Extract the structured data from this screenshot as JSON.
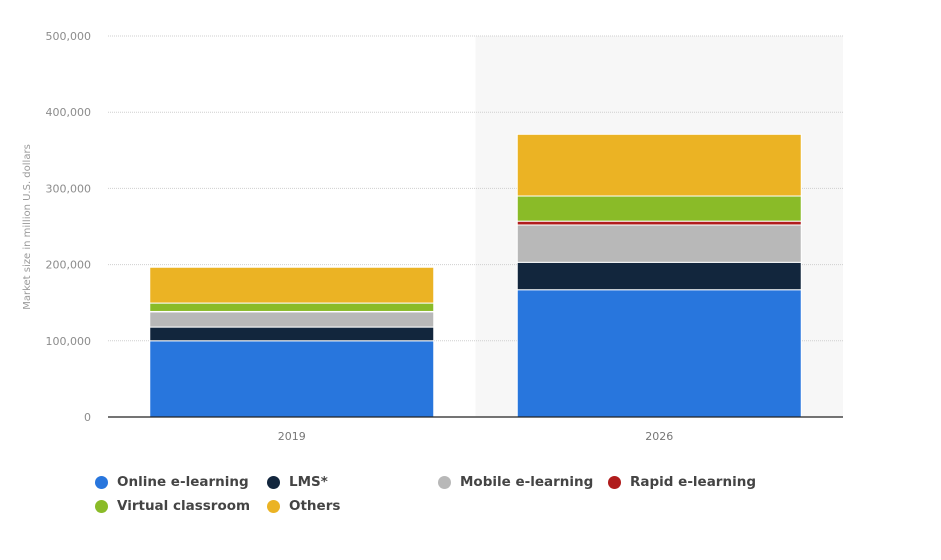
{
  "chart_data": {
    "type": "bar",
    "stacked": true,
    "title": "",
    "xlabel": "",
    "ylabel": "Market size in million U.S. dollars",
    "ylim": [
      0,
      500000
    ],
    "yticks": [
      0,
      100000,
      200000,
      300000,
      400000,
      500000
    ],
    "ytick_labels": [
      "0",
      "100,000",
      "200,000",
      "300,000",
      "400,000",
      "500,000"
    ],
    "grid": true,
    "highlighted_category": "2026",
    "categories": [
      "2019",
      "2026"
    ],
    "series": [
      {
        "name": "Online e-learning",
        "color": "#2876dd",
        "values": [
          100000,
          167000
        ]
      },
      {
        "name": "LMS*",
        "color": "#12263d",
        "values": [
          18000,
          36000
        ]
      },
      {
        "name": "Mobile e-learning",
        "color": "#b8b8b8",
        "values": [
          20000,
          49000
        ]
      },
      {
        "name": "Rapid e-learning",
        "color": "#b01c1c",
        "values": [
          500,
          5000
        ]
      },
      {
        "name": "Virtual classroom",
        "color": "#8abb28",
        "values": [
          11000,
          33000
        ]
      },
      {
        "name": "Others",
        "color": "#ebb324",
        "values": [
          47000,
          81000
        ]
      }
    ],
    "legend_position": "bottom-left"
  }
}
